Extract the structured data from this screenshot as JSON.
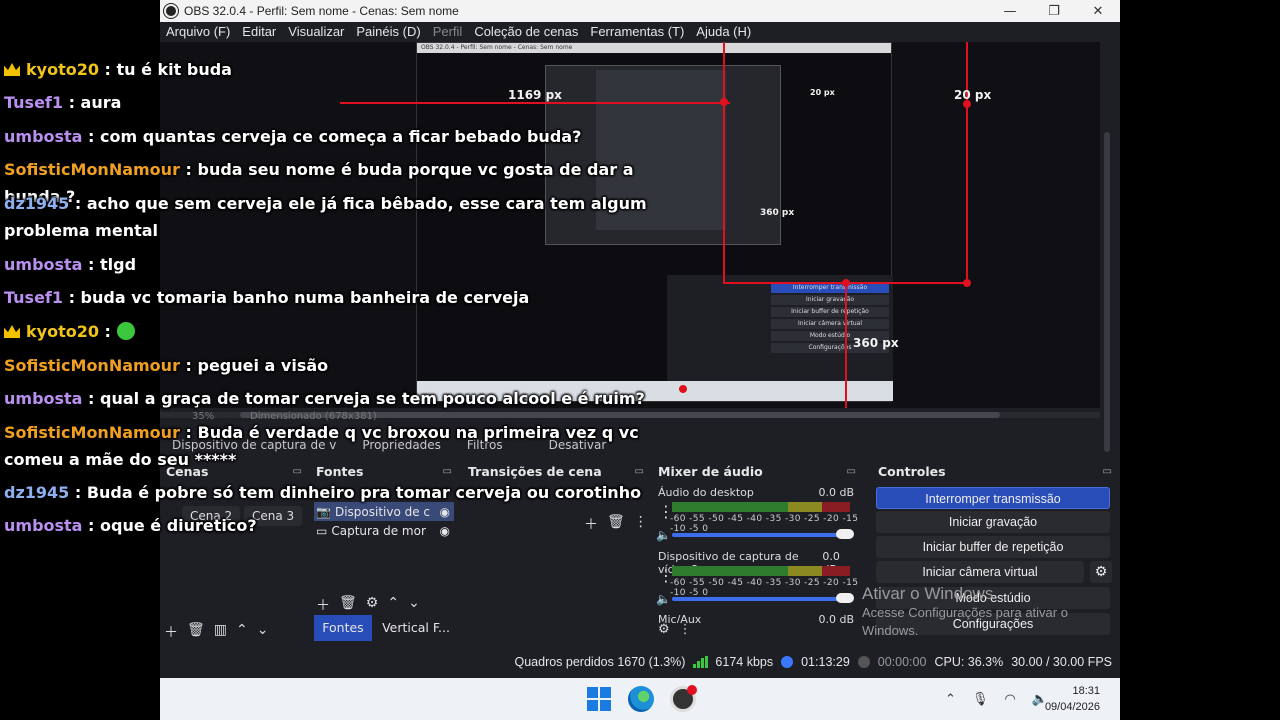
{
  "window": {
    "title": "OBS 32.0.4 - Perfil: Sem nome - Cenas: Sem nome",
    "minimize": "—",
    "maximize": "❐",
    "close": "✕"
  },
  "menu": [
    "Arquivo (F)",
    "Editar",
    "Visualizar",
    "Painéis (D)",
    "Perfil",
    "Coleção de cenas",
    "Ferramentas (T)",
    "Ajuda (H)"
  ],
  "preview": {
    "nested_title": "OBS 32.0.4 - Perfil: Sem nome - Cenas: Sem nome",
    "measure_top_right": "20 px",
    "measure_mid": "1169 px",
    "measure_small": "20 px",
    "measure_right_small": "360 px",
    "measure_bottom": "360 px",
    "nested_controls": [
      "Interromper transmissão",
      "Iniciar gravação",
      "Iniciar buffer de repetição",
      "Iniciar câmera virtual",
      "Modo estúdio",
      "Configurações"
    ]
  },
  "zoom": {
    "percent": "35%",
    "size": "Dimensionado (678x381)"
  },
  "source_toolbar": {
    "device": "Dispositivo de captura de v",
    "properties": "Propriedades",
    "filters": "Filtros",
    "deactivate": "Desativar"
  },
  "scenes": {
    "header": "Cenas",
    "items": [
      "Cena 2",
      "Cena 3"
    ]
  },
  "sources": {
    "header": "Fontes",
    "items": [
      "Dispositivo de c",
      "Captura de mor"
    ],
    "tabs": [
      "Fontes",
      "Vertical F..."
    ]
  },
  "transitions": {
    "header": "Transições de cena"
  },
  "mixer": {
    "header": "Mixer de áudio",
    "channels": [
      {
        "name": "Áudio do desktop",
        "db": "0.0 dB"
      },
      {
        "name": "Dispositivo de captura de vídeo 2",
        "db": "0.0 dB"
      },
      {
        "name": "Mic/Aux",
        "db": "0.0 dB"
      }
    ],
    "scale": "-60 -55 -50 -45 -40 -35 -30 -25 -20 -15 -10 -5 0"
  },
  "controls": {
    "header": "Controles",
    "buttons": [
      "Interromper transmissão",
      "Iniciar gravação",
      "Iniciar buffer de repetição",
      "Iniciar câmera virtual",
      "Modo estúdio",
      "Configurações"
    ]
  },
  "status": {
    "dropped": "Quadros perdidos 1670 (1.3%)",
    "bitrate": "6174 kbps",
    "stream_time": "01:13:29",
    "rec_time": "00:00:00",
    "cpu": "CPU: 36.3%",
    "fps": "30.00 / 30.00 FPS"
  },
  "watermark": {
    "line1": "Ativar o Windows",
    "line2": "Acesse Configurações para ativar o",
    "line3": "Windows."
  },
  "taskbar": {
    "time": "18:31",
    "date": "09/04/2026"
  },
  "chat": [
    {
      "user": "kyoto20",
      "text": ": tu é kit buda",
      "color": "#f0c419",
      "crown": true
    },
    {
      "user": "Tusef1",
      "text": ": aura",
      "color": "#b98ff0",
      "crown": false
    },
    {
      "user": "umbosta",
      "text": ": com quantas cerveja ce começa a ficar bebado buda?",
      "color": "#b98ff0",
      "crown": false
    },
    {
      "user": "SofisticMonNamour",
      "text": ": buda seu nome é buda porque vc gosta de dar a bunda ?",
      "color": "#f0a020",
      "crown": false
    },
    {
      "user": "dz1945",
      "text": ": acho que sem cerveja ele já fica bêbado, esse cara tem algum problema mental",
      "color": "#8fb0f0",
      "crown": false
    },
    {
      "user": "umbosta",
      "text": ": tlgd",
      "color": "#b98ff0",
      "crown": false
    },
    {
      "user": "Tusef1",
      "text": ": buda vc tomaria banho numa banheira de cerveja",
      "color": "#b98ff0",
      "crown": false
    },
    {
      "user": "kyoto20",
      "text": ":",
      "color": "#f0c419",
      "crown": true
    },
    {
      "user": "SofisticMonNamour",
      "text": ": peguei a visão",
      "color": "#f0a020",
      "crown": false
    },
    {
      "user": "umbosta",
      "text": ": qual a graça de tomar cerveja se tem pouco alcool e é ruim?",
      "color": "#b98ff0",
      "crown": false
    },
    {
      "user": "SofisticMonNamour",
      "text": ": Buda é verdade q vc broxou na primeira vez q vc comeu a mãe do seu *****",
      "color": "#f0a020",
      "crown": false
    },
    {
      "user": "dz1945",
      "text": ": Buda é pobre só tem dinheiro pra tomar cerveja ou corotinho",
      "color": "#8fb0f0",
      "crown": false
    },
    {
      "user": "umbosta",
      "text": ": oque é diuretico?",
      "color": "#b98ff0",
      "crown": false
    }
  ]
}
